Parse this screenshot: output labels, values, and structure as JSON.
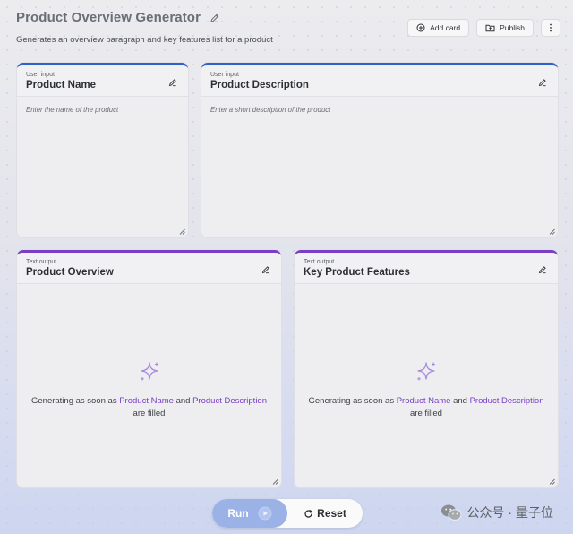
{
  "app": {
    "title": "Product Overview Generator",
    "subtitle": "Generates an overview paragraph and key features list for a product"
  },
  "toolbar": {
    "add_card_label": "Add card",
    "publish_label": "Publish",
    "more_icon": "more-vertical-icon"
  },
  "cards": {
    "product_name": {
      "kind": "User input",
      "title": "Product Name",
      "placeholder": "Enter the name of the product"
    },
    "product_description": {
      "kind": "User input",
      "title": "Product Description",
      "placeholder": "Enter a short description of the product"
    },
    "product_overview": {
      "kind": "Text output",
      "title": "Product Overview",
      "gen_prefix": "Generating as soon as ",
      "gen_field1": "Product Name",
      "gen_and": " and ",
      "gen_field2": "Product Description",
      "gen_suffix": " are filled"
    },
    "key_features": {
      "kind": "Text output",
      "title": "Key Product Features",
      "gen_prefix": "Generating as soon as ",
      "gen_field1": "Product Name",
      "gen_and": " and ",
      "gen_field2": "Product Description",
      "gen_suffix": " are filled"
    }
  },
  "actions": {
    "run_label": "Run",
    "reset_label": "Reset"
  },
  "watermark": {
    "text": "公众号 · 量子位"
  },
  "colors": {
    "input_accent": "#2f62c9",
    "output_accent": "#7a3ec6",
    "run_button": "#9bb2e6"
  }
}
